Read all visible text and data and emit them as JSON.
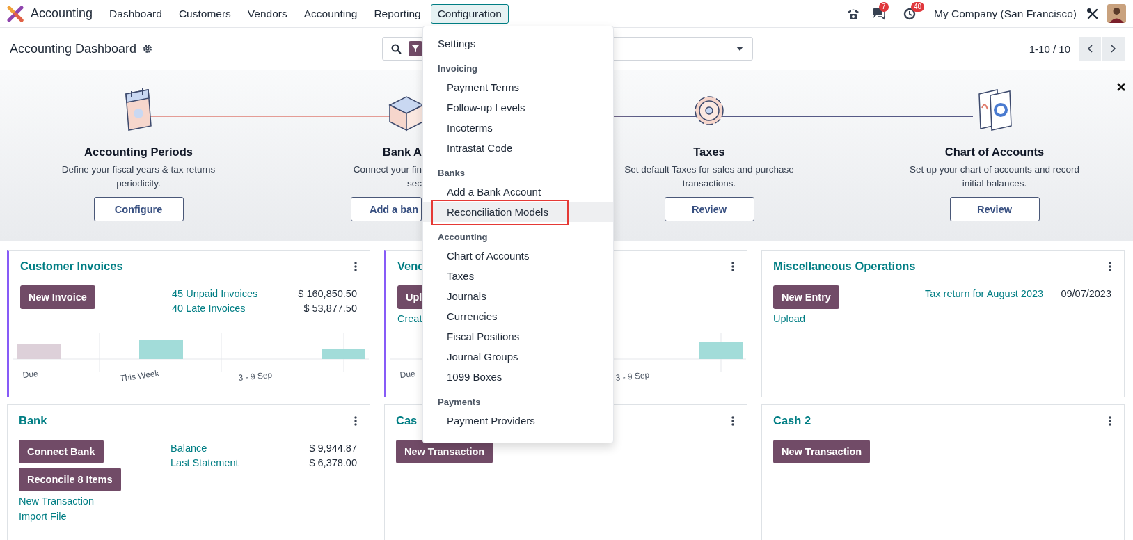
{
  "app": {
    "name": "Accounting"
  },
  "nav": [
    {
      "label": "Dashboard",
      "selected": false
    },
    {
      "label": "Customers",
      "selected": false
    },
    {
      "label": "Vendors",
      "selected": false
    },
    {
      "label": "Accounting",
      "selected": false
    },
    {
      "label": "Reporting",
      "selected": false
    },
    {
      "label": "Configuration",
      "selected": true
    }
  ],
  "systray": {
    "messages_badge": "7",
    "activities_badge": "40",
    "company": "My Company (San Francisco)"
  },
  "control_panel": {
    "title": "Accounting Dashboard",
    "pager": "1-10 / 10"
  },
  "onboarding": [
    {
      "title": "Accounting Periods",
      "description": [
        "Define your fiscal years & tax returns",
        "periodicity."
      ],
      "button": "Configure"
    },
    {
      "title": "Bank A",
      "description": [
        "Connect your fin",
        "sec"
      ],
      "button": "Add a ban"
    },
    {
      "title": "Taxes",
      "description": [
        "Set default Taxes for sales and purchase",
        "transactions."
      ],
      "button": "Review"
    },
    {
      "title": "Chart of Accounts",
      "description": [
        "Set up your chart of accounts and record",
        "initial balances."
      ],
      "button": "Review"
    }
  ],
  "cards": [
    {
      "title": "Customer Invoices",
      "accent": true,
      "buttons": [
        "New Invoice"
      ],
      "stats": [
        {
          "label": "45 Unpaid Invoices",
          "value": "$ 160,850.50"
        },
        {
          "label": "40 Late Invoices",
          "value": "$ 53,877.50"
        }
      ],
      "chart": {
        "due_label": "Due",
        "week_label": "This Week",
        "range_label": "3 - 9 Sep"
      }
    },
    {
      "title": "Vend",
      "accent": true,
      "buttons": [
        "Upl"
      ],
      "links": [
        "Creat"
      ],
      "chart": {
        "due_label": "Due",
        "range_label": "3 - 9 Sep"
      }
    },
    {
      "title": "Miscellaneous Operations",
      "accent": false,
      "buttons": [
        "New Entry"
      ],
      "links": [
        "Upload"
      ],
      "stats": [
        {
          "label": "Tax return for August 2023",
          "value": "09/07/2023"
        }
      ]
    },
    {
      "title": "Bank",
      "accent": false,
      "buttons": [
        "Connect Bank",
        "Reconcile 8 Items"
      ],
      "links": [
        "New Transaction",
        "Import File"
      ],
      "stats": [
        {
          "label": "Balance",
          "value": "$ 9,944.87"
        },
        {
          "label": "Last Statement",
          "value": "$ 6,378.00"
        }
      ]
    },
    {
      "title": "Cas",
      "accent": false,
      "buttons": [
        "New Transaction"
      ]
    },
    {
      "title": "Cash 2",
      "accent": false,
      "buttons": [
        "New Transaction"
      ]
    }
  ],
  "menu": [
    {
      "kind": "top",
      "label": "Settings",
      "highlighted": false
    },
    {
      "kind": "header",
      "label": "Invoicing"
    },
    {
      "kind": "item",
      "label": "Payment Terms",
      "highlighted": false
    },
    {
      "kind": "item",
      "label": "Follow-up Levels",
      "highlighted": false
    },
    {
      "kind": "item",
      "label": "Incoterms",
      "highlighted": false
    },
    {
      "kind": "item",
      "label": "Intrastat Code",
      "highlighted": false
    },
    {
      "kind": "header",
      "label": "Banks"
    },
    {
      "kind": "item",
      "label": "Add a Bank Account",
      "highlighted": false
    },
    {
      "kind": "item",
      "label": "Reconciliation Models",
      "highlighted": true
    },
    {
      "kind": "header",
      "label": "Accounting"
    },
    {
      "kind": "item",
      "label": "Chart of Accounts",
      "highlighted": false
    },
    {
      "kind": "item",
      "label": "Taxes",
      "highlighted": false
    },
    {
      "kind": "item",
      "label": "Journals",
      "highlighted": false
    },
    {
      "kind": "item",
      "label": "Currencies",
      "highlighted": false
    },
    {
      "kind": "item",
      "label": "Fiscal Positions",
      "highlighted": false
    },
    {
      "kind": "item",
      "label": "Journal Groups",
      "highlighted": false
    },
    {
      "kind": "item",
      "label": "1099 Boxes",
      "highlighted": false
    },
    {
      "kind": "header",
      "label": "Payments"
    },
    {
      "kind": "item",
      "label": "Payment Providers",
      "highlighted": false
    }
  ]
}
